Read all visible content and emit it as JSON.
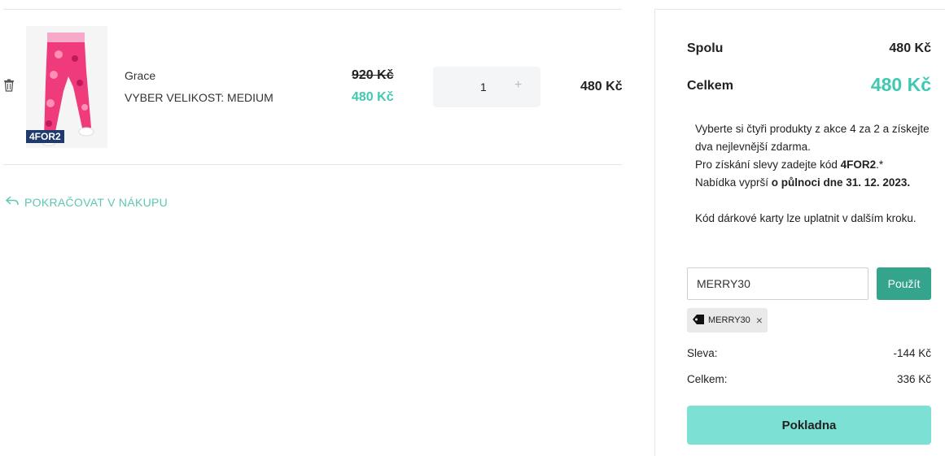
{
  "cart": {
    "item": {
      "badge": "4FOR2",
      "name": "Grace",
      "variant": "VYBER VELIKOST: MEDIUM",
      "old_price": "920 Kč",
      "new_price": "480 Kč",
      "quantity": "1",
      "plus": "+",
      "line_total": "480 Kč"
    },
    "continue_label": "POKRAČOVAT V NÁKUPU"
  },
  "summary": {
    "subtotal_label": "Spolu",
    "subtotal_value": "480 Kč",
    "total_label": "Celkem",
    "total_value": "480 Kč",
    "promo": {
      "line1": "Vyberte si čtyři produkty z akce 4 za 2 a získejte dva nejlevnější zdarma.",
      "line2_prefix": "Pro získání slevy zadejte kód ",
      "code": "4FOR2",
      "line2_suffix": ".*",
      "line3_prefix": "Nabídka vyprší ",
      "deadline": "o půlnoci dne 31. 12. 2023.",
      "giftcard_note": "Kód dárkové karty lze uplatnit v dalším kroku."
    },
    "coupon": {
      "value": "MERRY30",
      "apply_label": "Použít",
      "applied_code": "MERRY30"
    },
    "discount_label": "Sleva:",
    "discount_value": "-144 Kč",
    "final_label": "Celkem:",
    "final_value": "336 Kč",
    "checkout_label": "Pokladna"
  },
  "colors": {
    "accent": "#40c9b0",
    "apply_button": "#35a48d",
    "checkout_button": "#7ce1d4",
    "badge": "#1e3b6b"
  }
}
